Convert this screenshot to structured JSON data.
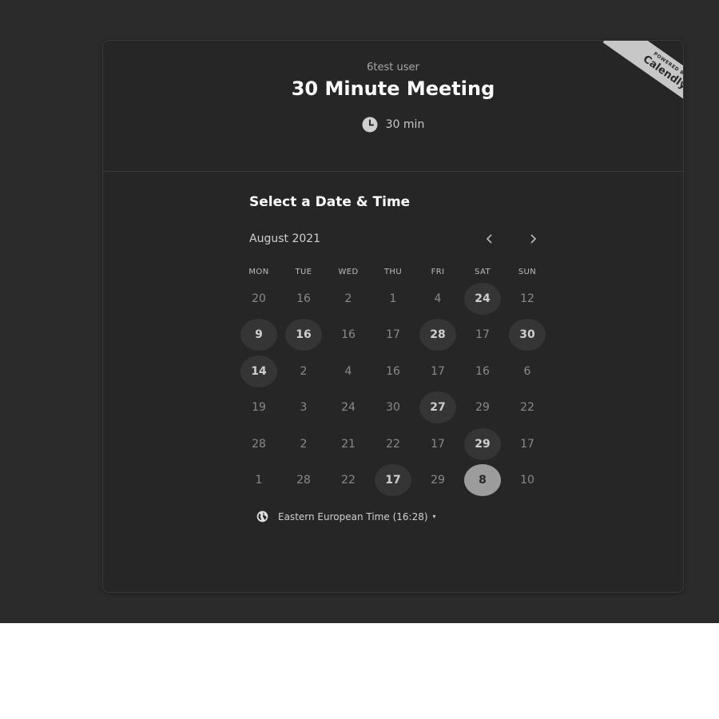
{
  "header": {
    "owner": "6test user",
    "title": "30 Minute Meeting",
    "duration": "30 min"
  },
  "badge": {
    "small": "POWERED BY",
    "big": "Calendly"
  },
  "scheduler": {
    "section_title": "Select a Date & Time",
    "month_label": "August 2021",
    "prev_icon": "chevron-left-icon",
    "next_icon": "chevron-right-icon",
    "weekdays": [
      "MON",
      "TUE",
      "WED",
      "THU",
      "FRI",
      "SAT",
      "SUN"
    ],
    "weeks": [
      [
        {
          "d": "20",
          "s": "off"
        },
        {
          "d": "16",
          "s": "off"
        },
        {
          "d": "2",
          "s": "off"
        },
        {
          "d": "1",
          "s": "off"
        },
        {
          "d": "4",
          "s": "off"
        },
        {
          "d": "24",
          "s": "available"
        },
        {
          "d": "12",
          "s": "off"
        }
      ],
      [
        {
          "d": "9",
          "s": "available"
        },
        {
          "d": "16",
          "s": "available"
        },
        {
          "d": "16",
          "s": "off"
        },
        {
          "d": "17",
          "s": "off"
        },
        {
          "d": "28",
          "s": "available"
        },
        {
          "d": "17",
          "s": "off"
        },
        {
          "d": "30",
          "s": "available"
        }
      ],
      [
        {
          "d": "14",
          "s": "available"
        },
        {
          "d": "2",
          "s": "off"
        },
        {
          "d": "4",
          "s": "off"
        },
        {
          "d": "16",
          "s": "off"
        },
        {
          "d": "17",
          "s": "off"
        },
        {
          "d": "16",
          "s": "off"
        },
        {
          "d": "6",
          "s": "off"
        }
      ],
      [
        {
          "d": "19",
          "s": "off"
        },
        {
          "d": "3",
          "s": "off"
        },
        {
          "d": "24",
          "s": "off"
        },
        {
          "d": "30",
          "s": "off"
        },
        {
          "d": "27",
          "s": "available"
        },
        {
          "d": "29",
          "s": "off"
        },
        {
          "d": "22",
          "s": "off"
        }
      ],
      [
        {
          "d": "28",
          "s": "off"
        },
        {
          "d": "2",
          "s": "off"
        },
        {
          "d": "21",
          "s": "off"
        },
        {
          "d": "22",
          "s": "off"
        },
        {
          "d": "17",
          "s": "off"
        },
        {
          "d": "29",
          "s": "available"
        },
        {
          "d": "17",
          "s": "off"
        }
      ],
      [
        {
          "d": "1",
          "s": "off"
        },
        {
          "d": "28",
          "s": "off"
        },
        {
          "d": "22",
          "s": "off"
        },
        {
          "d": "17",
          "s": "available"
        },
        {
          "d": "29",
          "s": "off"
        },
        {
          "d": "8",
          "s": "selected"
        },
        {
          "d": "10",
          "s": "off"
        }
      ]
    ]
  },
  "timezone": {
    "label": "Eastern European Time (16:28)",
    "icon": "globe-icon",
    "caret": "▾"
  },
  "colors": {
    "page_bg": "#2b2b2b",
    "card_bg": "#262626",
    "available_bg": "#353535",
    "selected_bg": "#9c9c9c",
    "badge_bg": "#c7c7c7"
  }
}
